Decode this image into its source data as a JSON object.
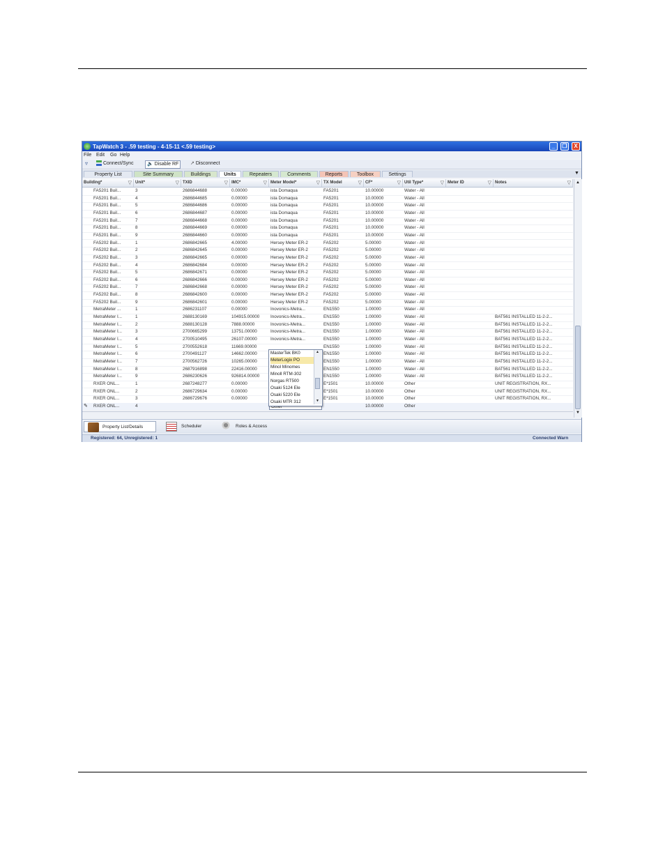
{
  "window": {
    "title": "TapWatch 3 - .59 testing - 4-15-11 <.59 testing>",
    "controls": [
      "_",
      "❐",
      "X"
    ]
  },
  "menu": [
    "File",
    "Edit",
    "Go",
    "Help"
  ],
  "toolbar": {
    "connect": "Connect/Sync",
    "disable_rf": "Disable RF",
    "disconnect": "Disconnect"
  },
  "tabs": [
    {
      "label": "Property List"
    },
    {
      "label": "Site Summary"
    },
    {
      "label": "Buildings"
    },
    {
      "label": "Units"
    },
    {
      "label": "Repeaters"
    },
    {
      "label": "Comments"
    },
    {
      "label": "Reports"
    },
    {
      "label": "Toolbox"
    },
    {
      "label": "Settings"
    }
  ],
  "columns": [
    "Building*",
    "Unit*",
    "TXID",
    "IMC*",
    "Meter Model*",
    "TX Model",
    "CF*",
    "Util Type*",
    "Meter ID",
    "Notes"
  ],
  "rows": [
    [
      "FA5201 Buil...",
      "3",
      "2686844688",
      "0.00000",
      "ista Domaqua",
      "FA5201",
      "10.00000",
      "Water - All",
      "",
      ""
    ],
    [
      "FA5201 Buil...",
      "4",
      "2686844685",
      "0.00000",
      "ista Domaqua",
      "FA5201",
      "10.00000",
      "Water - All",
      "",
      ""
    ],
    [
      "FA5201 Buil...",
      "5",
      "2686844686",
      "0.00000",
      "ista Domaqua",
      "FA5201",
      "10.00000",
      "Water - All",
      "",
      ""
    ],
    [
      "FA5201 Buil...",
      "6",
      "2686844687",
      "0.00000",
      "ista Domaqua",
      "FA5201",
      "10.00000",
      "Water - All",
      "",
      ""
    ],
    [
      "FA5201 Buil...",
      "7",
      "2686844668",
      "0.00000",
      "ista Domaqua",
      "FA5201",
      "10.00000",
      "Water - All",
      "",
      ""
    ],
    [
      "FA5201 Buil...",
      "8",
      "2686844669",
      "0.00000",
      "ista Domaqua",
      "FA5201",
      "10.00000",
      "Water - All",
      "",
      ""
    ],
    [
      "FA5201 Buil...",
      "9",
      "2686844660",
      "0.00000",
      "ista Domaqua",
      "FA5201",
      "10.00000",
      "Water - All",
      "",
      ""
    ],
    [
      "FA5202 Buil...",
      "1",
      "2686842665",
      "4.00000",
      "Hersey Meter ER-2",
      "FA5202",
      "5.00000",
      "Water - All",
      "",
      ""
    ],
    [
      "FA5202 Buil...",
      "2",
      "2686842645",
      "0.00000",
      "Hersey Meter ER-2",
      "FA5202",
      "5.00000",
      "Water - All",
      "",
      ""
    ],
    [
      "FA5202 Buil...",
      "3",
      "2686842665",
      "0.00000",
      "Hersey Meter ER-2",
      "FA5202",
      "5.00000",
      "Water - All",
      "",
      ""
    ],
    [
      "FA5202 Buil...",
      "4",
      "2686842684",
      "0.00000",
      "Hersey Meter ER-2",
      "FA5202",
      "5.00000",
      "Water - All",
      "",
      ""
    ],
    [
      "FA5202 Buil...",
      "5",
      "2686842671",
      "0.00000",
      "Hersey Meter ER-2",
      "FA5202",
      "5.00000",
      "Water - All",
      "",
      ""
    ],
    [
      "FA5202 Buil...",
      "6",
      "2686842666",
      "0.00000",
      "Hersey Meter ER-2",
      "FA5202",
      "5.00000",
      "Water - All",
      "",
      ""
    ],
    [
      "FA5202 Buil...",
      "7",
      "2686842668",
      "0.00000",
      "Hersey Meter ER-2",
      "FA5202",
      "5.00000",
      "Water - All",
      "",
      ""
    ],
    [
      "FA5202 Buil...",
      "8",
      "2686842600",
      "0.00000",
      "Hersey Meter ER-2",
      "FA5202",
      "5.00000",
      "Water - All",
      "",
      ""
    ],
    [
      "FA5202 Buil...",
      "9",
      "2686842601",
      "0.00000",
      "Hersey Meter ER-2",
      "FA5202",
      "5.00000",
      "Water - All",
      "",
      ""
    ],
    [
      "MetraMeter ...",
      "1",
      "2686231107",
      "0.00000",
      "Inovonics-Metra...",
      "EN1550",
      "1.00000",
      "Water - All",
      "",
      ""
    ],
    [
      "MetraMeter I...",
      "1",
      "2688130169",
      "104915.00000",
      "Inovonics-Metra...",
      "EN1550",
      "1.00000",
      "Water - All",
      "",
      "BAT561 INSTALLED 11-2-2..."
    ],
    [
      "MetraMeter I...",
      "2",
      "2688130128",
      "7888.00000",
      "Inovonics-Metra...",
      "EN1550",
      "1.00000",
      "Water - All",
      "",
      "BAT561 INSTALLED 11-2-2..."
    ],
    [
      "MetraMeter I...",
      "3",
      "2700665299",
      "13751.00000",
      "Inovonics-Metra...",
      "EN1550",
      "1.00000",
      "Water - All",
      "",
      "BAT561 INSTALLED 11-2-2..."
    ],
    [
      "MetraMeter I...",
      "4",
      "2700510495",
      "26107.00000",
      "Inovonics-Metra...",
      "EN1550",
      "1.00000",
      "Water - All",
      "",
      "BAT561 INSTALLED 11-2-2..."
    ],
    [
      "MetraMeter I...",
      "5",
      "2700552618",
      "11669.00000",
      "",
      "EN1550",
      "1.00000",
      "Water - All",
      "",
      "BAT561 INSTALLED 11-2-2..."
    ],
    [
      "MetraMeter I...",
      "6",
      "2700491127",
      "14662.00000",
      "",
      "EN1550",
      "1.00000",
      "Water - All",
      "",
      "BAT561 INSTALLED 11-2-2..."
    ],
    [
      "MetraMeter I...",
      "7",
      "2700562726",
      "10265.00000",
      "",
      "EN1550",
      "1.00000",
      "Water - All",
      "",
      "BAT561 INSTALLED 11-2-2..."
    ],
    [
      "MetraMeter I...",
      "8",
      "2687916898",
      "22416.00000",
      "",
      "EN1550",
      "1.00000",
      "Water - All",
      "",
      "BAT561 INSTALLED 11-2-2..."
    ],
    [
      "MetraMeter I...",
      "9",
      "2686230626",
      "926814.00000",
      "",
      "EN1550",
      "1.00000",
      "Water - All",
      "",
      "BAT561 INSTALLED 11-2-2..."
    ],
    [
      "RXER ONL...",
      "1",
      "2687248277",
      "0.00000",
      "",
      "E*1501",
      "10.00000",
      "Other",
      "",
      "UNIT REGISTRATION, RX..."
    ],
    [
      "RXER ONL...",
      "2",
      "2686729634",
      "0.00000",
      "",
      "E*1501",
      "10.00000",
      "Other",
      "",
      "UNIT REGISTRATION, RX..."
    ],
    [
      "RXER ONL...",
      "3",
      "2686729676",
      "0.00000",
      "",
      "E*1501",
      "10.00000",
      "Other",
      "",
      "UNIT REGISTRATION, RX..."
    ],
    [
      "RXER ONL...",
      "4",
      "",
      "",
      "Other",
      "",
      "10.00000",
      "Other",
      "",
      ""
    ]
  ],
  "dropdown": {
    "options": [
      "MasterTek BK0",
      "MeterLogix PO",
      "Minol Minomes",
      "Minoll RTM-302",
      "Norgas RT500",
      "Osaki 5124 Ele",
      "Osaki 5220 Ele",
      "Osaki MTR 312"
    ],
    "selected_index": 1
  },
  "bottom_nav": [
    {
      "label": "Property List/Details",
      "active": true
    },
    {
      "label": "Scheduler",
      "active": false
    },
    {
      "label": "Roles & Access",
      "active": false
    }
  ],
  "status": {
    "left": "Registered: 64, Unregistered: 1",
    "right": "Connected Warn"
  },
  "colors": {
    "titlebar": "#1f56c8",
    "tab_reports": "#f4c4b6",
    "tab_toolbox": "#f6d0c2",
    "selected_option": "#f7e9a9"
  }
}
